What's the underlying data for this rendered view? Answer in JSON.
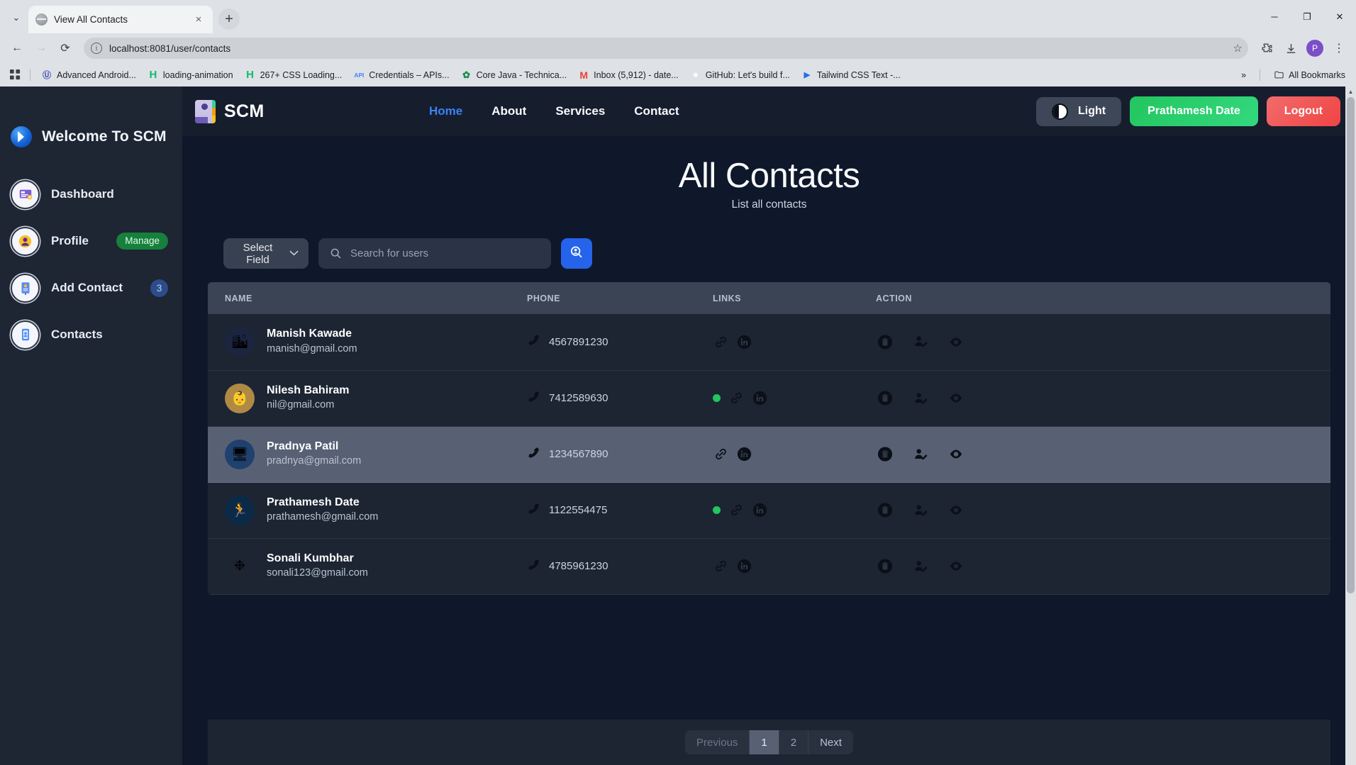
{
  "browser": {
    "tab": {
      "title": "View All Contacts",
      "favicon": "globe-icon",
      "close": "×"
    },
    "new_tab": "+",
    "tab_list_chevron": "⌄",
    "window_controls": {
      "minimize": "─",
      "maximize": "❐",
      "close": "✕"
    },
    "nav": {
      "back": "←",
      "forward": "→",
      "reload": "⟳"
    },
    "omnibox": {
      "url": "localhost:8081/user/contacts",
      "info": "i",
      "star": "☆"
    },
    "extensions_icon": "puzzle-icon",
    "download_icon": "download-icon",
    "profile_initial": "P",
    "menu_icon": "⋮",
    "bookmarks": [
      {
        "label": "Advanced Android...",
        "icon": "Ⓤ",
        "color": "#3f51b5"
      },
      {
        "label": "loading-animation",
        "icon": "H",
        "color": "#0ebd6f"
      },
      {
        "label": "267+ CSS Loading...",
        "icon": "H",
        "color": "#0ebd6f"
      },
      {
        "label": "Credentials – APIs...",
        "icon": "API",
        "color": "#4285f4"
      },
      {
        "label": "Core Java - Technica...",
        "icon": "✿",
        "color": "#1a8b4d"
      },
      {
        "label": "Inbox (5,912) - date...",
        "icon": "M",
        "color": "#ea4335"
      },
      {
        "label": "GitHub: Let's build f...",
        "icon": "●",
        "color": "#f6f8fa"
      },
      {
        "label": "Tailwind CSS Text -...",
        "icon": "▶",
        "color": "#1f6feb"
      }
    ],
    "bookmarks_overflow": "»",
    "all_bookmarks": {
      "label": "All Bookmarks",
      "icon": "folder-icon"
    }
  },
  "sidebar": {
    "brand": {
      "label": "Welcome To SCM",
      "icon": "scm-logo-icon"
    },
    "items": [
      {
        "label": "Dashboard",
        "icon": "dashboard-icon",
        "badge": null,
        "badge_type": null
      },
      {
        "label": "Profile",
        "icon": "profile-icon",
        "badge": "Manage",
        "badge_type": "pill"
      },
      {
        "label": "Add Contact",
        "icon": "add-contact-icon",
        "badge": "3",
        "badge_type": "count"
      },
      {
        "label": "Contacts",
        "icon": "contacts-icon",
        "badge": null,
        "badge_type": null
      }
    ]
  },
  "navbar": {
    "brand": "SCM",
    "links": [
      {
        "label": "Home",
        "active": true
      },
      {
        "label": "About",
        "active": false
      },
      {
        "label": "Services",
        "active": false
      },
      {
        "label": "Contact",
        "active": false
      }
    ],
    "theme_toggle": {
      "label": "Light",
      "icon": "half-moon-icon"
    },
    "user_button": "Prathamesh Date",
    "logout_button": "Logout"
  },
  "main": {
    "title": "All Contacts",
    "subtitle": "List all contacts",
    "controls": {
      "select_field_label": "Select Field",
      "select_chevron": "⌄",
      "search_placeholder": "Search for users",
      "search_value": "",
      "search_button_icon": "user-search-icon"
    },
    "table": {
      "headers": [
        "NAME",
        "PHONE",
        "LINKS",
        "ACTION"
      ],
      "rows": [
        {
          "name": "Manish Kawade",
          "email": "manish@gmail.com",
          "phone": "4567891230",
          "avatar_glyph": "🏙",
          "avatar_bg": "#1b2540",
          "has_status_dot": false,
          "links": [
            "link-icon",
            "linkedin-icon"
          ],
          "actions": [
            "delete-icon",
            "edit-user-icon",
            "view-icon"
          ],
          "highlighted": false
        },
        {
          "name": "Nilesh Bahiram",
          "email": "nil@gmail.com",
          "phone": "7412589630",
          "avatar_glyph": "👶",
          "avatar_bg": "#b08a45",
          "has_status_dot": true,
          "links": [
            "link-icon",
            "linkedin-icon"
          ],
          "actions": [
            "delete-icon",
            "edit-user-icon",
            "view-icon"
          ],
          "highlighted": false
        },
        {
          "name": "Pradnya Patil",
          "email": "pradnya@gmail.com",
          "phone": "1234567890",
          "avatar_glyph": "🖥",
          "avatar_bg": "#20406e",
          "has_status_dot": false,
          "links": [
            "link-icon",
            "linkedin-icon"
          ],
          "actions": [
            "delete-icon",
            "edit-user-icon",
            "view-icon"
          ],
          "highlighted": true
        },
        {
          "name": "Prathamesh Date",
          "email": "prathamesh@gmail.com",
          "phone": "1122554475",
          "avatar_glyph": "🏃",
          "avatar_bg": "#0b2a47",
          "has_status_dot": true,
          "links": [
            "link-icon",
            "linkedin-icon"
          ],
          "actions": [
            "delete-icon",
            "edit-user-icon",
            "view-icon"
          ],
          "highlighted": false
        },
        {
          "name": "Sonali Kumbhar",
          "email": "sonali123@gmail.com",
          "phone": "4785961230",
          "avatar_glyph": "❉",
          "avatar_bg": "#1d2533",
          "has_status_dot": false,
          "links": [
            "link-icon",
            "linkedin-icon"
          ],
          "actions": [
            "delete-icon",
            "edit-user-icon",
            "view-icon"
          ],
          "highlighted": false
        }
      ]
    },
    "pagination": {
      "previous": "Previous",
      "pages": [
        "1",
        "2"
      ],
      "active_page": "1",
      "next": "Next"
    }
  },
  "colors": {
    "accent_blue": "#2563eb",
    "nav_active": "#3b82f6",
    "green": "#22c55e",
    "red": "#ef4444",
    "page_bg": "#0f172a",
    "sidebar_bg": "#1e2533",
    "row_bg": "#1d2533",
    "row_highlight": "#586174",
    "table_header_bg": "#3a4454"
  }
}
